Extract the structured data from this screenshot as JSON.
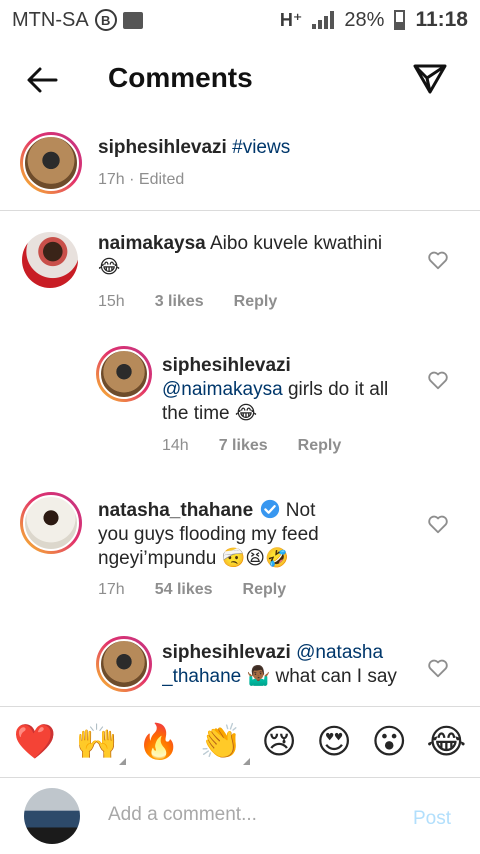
{
  "status_bar": {
    "carrier": "MTN-SA",
    "badge": "B",
    "network": "H⁺",
    "battery": "28%",
    "time": "11:18"
  },
  "header": {
    "title": "Comments"
  },
  "caption": {
    "username": "siphesihlevazi",
    "hashtag": "#views",
    "time": "17h",
    "edited": "· Edited"
  },
  "comments": [
    {
      "username": "naimakaysa",
      "text": "Aibo kuvele kwathini",
      "emoji": "😂",
      "time": "15h",
      "likes": "3 likes",
      "reply": "Reply"
    },
    {
      "username": "siphesihlevazi",
      "mention": "@naimakaysa",
      "text": "girls do it all the time",
      "emoji": "😂",
      "time": "14h",
      "likes": "7 likes",
      "reply": "Reply"
    },
    {
      "username": "natasha_thahane",
      "text": "Not you guys flooding my feed ngeyi’mpundu",
      "emoji": "🤕😫🤣",
      "time": "17h",
      "likes": "54 likes",
      "reply": "Reply"
    },
    {
      "username": "siphesihlevazi",
      "mention": "@natasha _thahane",
      "emoji": "🤷🏾‍♂️",
      "text": "what can I say"
    }
  ],
  "emoji_bar": [
    "❤️",
    "🙌",
    "🔥",
    "👏",
    "😢",
    "😍",
    "😮",
    "😂"
  ],
  "input": {
    "placeholder": "Add a comment...",
    "post_label": "Post"
  },
  "colors": {
    "link": "#00376b",
    "meta": "#8e8e8e",
    "post_disabled": "#b2dffc",
    "verified": "#3897f0"
  }
}
